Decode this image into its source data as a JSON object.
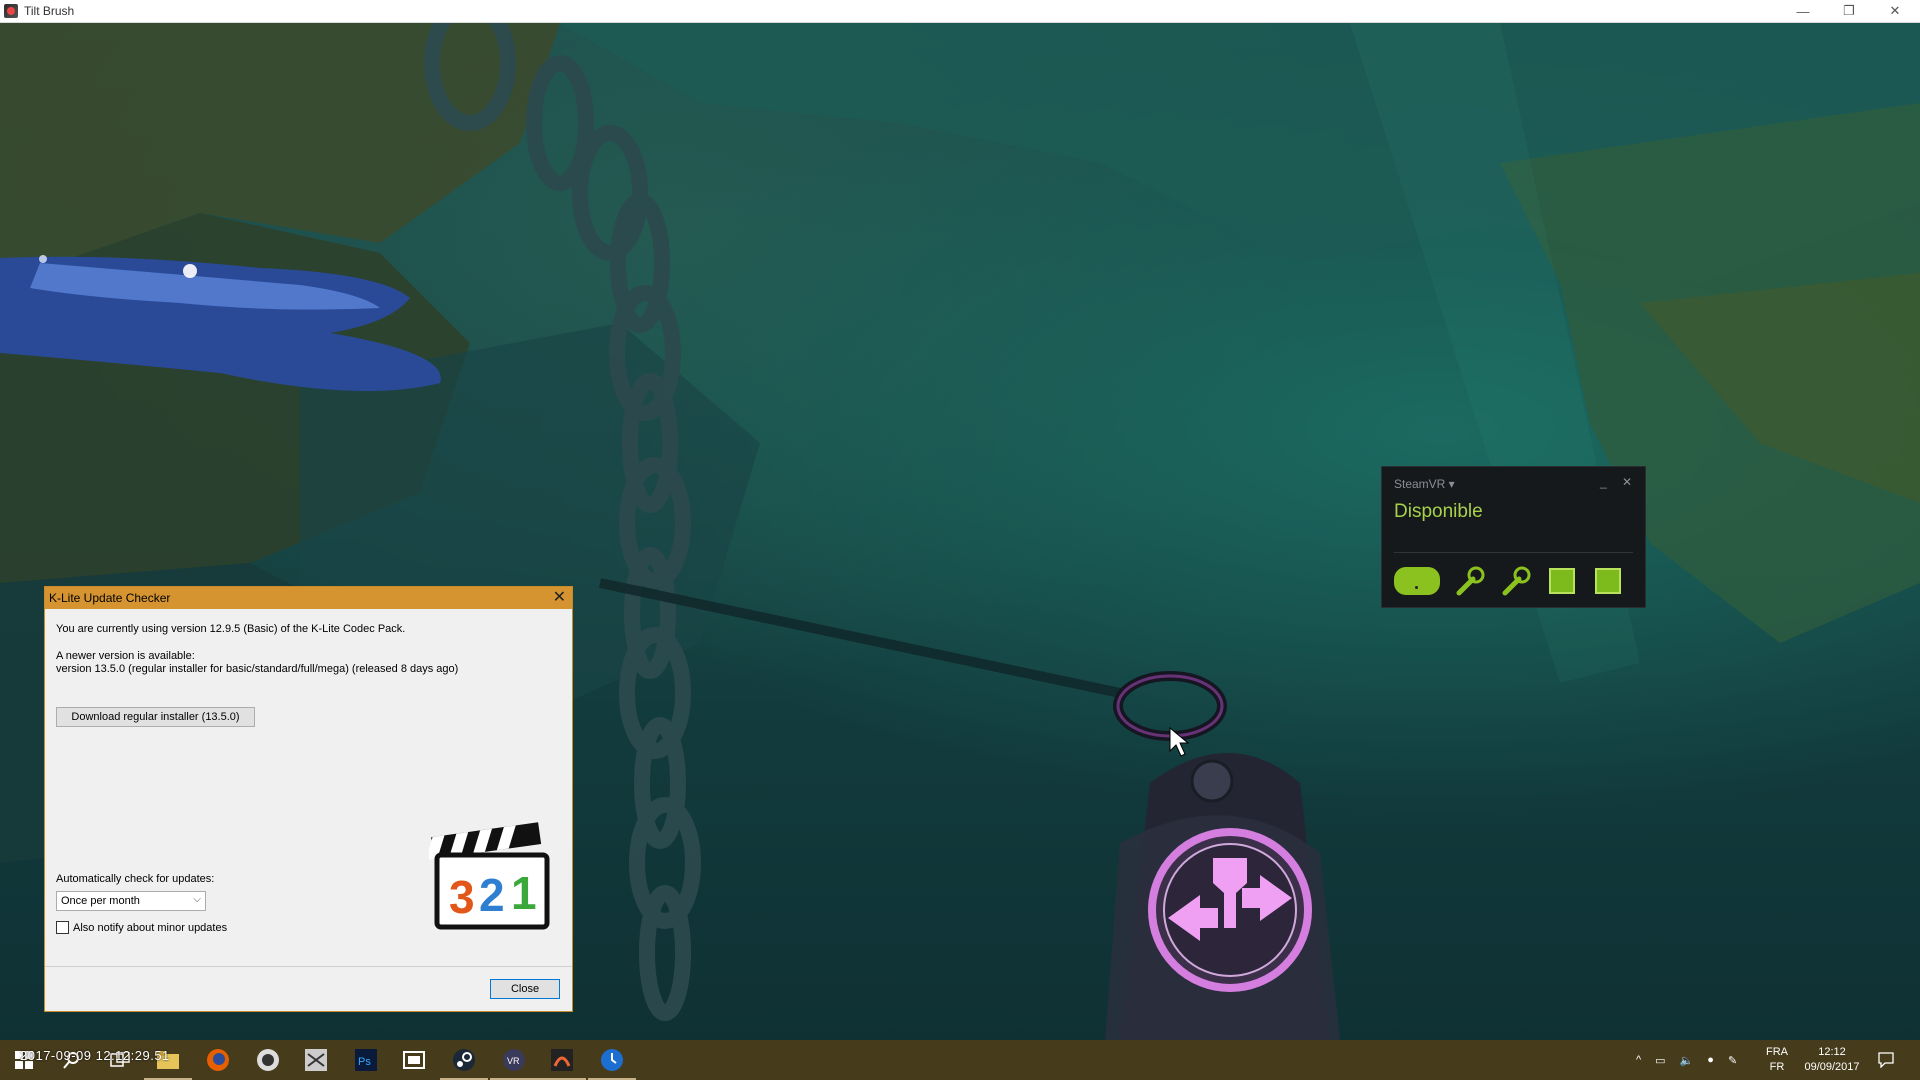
{
  "window": {
    "title": "Tilt Brush",
    "minimize_icon": "minimize-icon",
    "restore_icon": "restore-icon",
    "close_icon": "close-icon"
  },
  "steamvr": {
    "header": "SteamVR ▾",
    "status": "Disponible",
    "status_color": "#a7d14b",
    "devices": [
      "headset-icon",
      "controller-icon",
      "controller-icon",
      "base-station-icon",
      "base-station-icon"
    ]
  },
  "klite": {
    "title": "K-Lite Update Checker",
    "current_version_text": "You are currently using version 12.9.5 (Basic) of the K-Lite Codec Pack.",
    "newer_available_text": "A newer version is available:",
    "newer_version_detail": "version 13.5.0  (regular installer for basic/standard/full/mega)  (released 8 days ago)",
    "download_button": "Download regular installer (13.5.0)",
    "auto_check_label": "Automatically check for updates:",
    "auto_check_value": "Once per month",
    "minor_updates_label": "Also notify about minor updates",
    "minor_updates_checked": false,
    "close_button": "Close",
    "logo_digits": [
      "3",
      "2",
      "1"
    ]
  },
  "taskbar": {
    "overlay_timestamp": "2017-09-09 12:12:29.51",
    "pinned": [
      "windows-start-icon",
      "search-icon",
      "task-view-icon",
      "file-explorer-icon",
      "firefox-icon",
      "obs-icon",
      "zbrush-icon",
      "photoshop-icon",
      "media-classic-icon",
      "steam-icon",
      "vr-icon",
      "tilt-brush-icon",
      "clock-app-icon"
    ],
    "language_top": "FRA",
    "language_bottom": "FR",
    "time": "12:12",
    "date": "09/09/2017"
  }
}
